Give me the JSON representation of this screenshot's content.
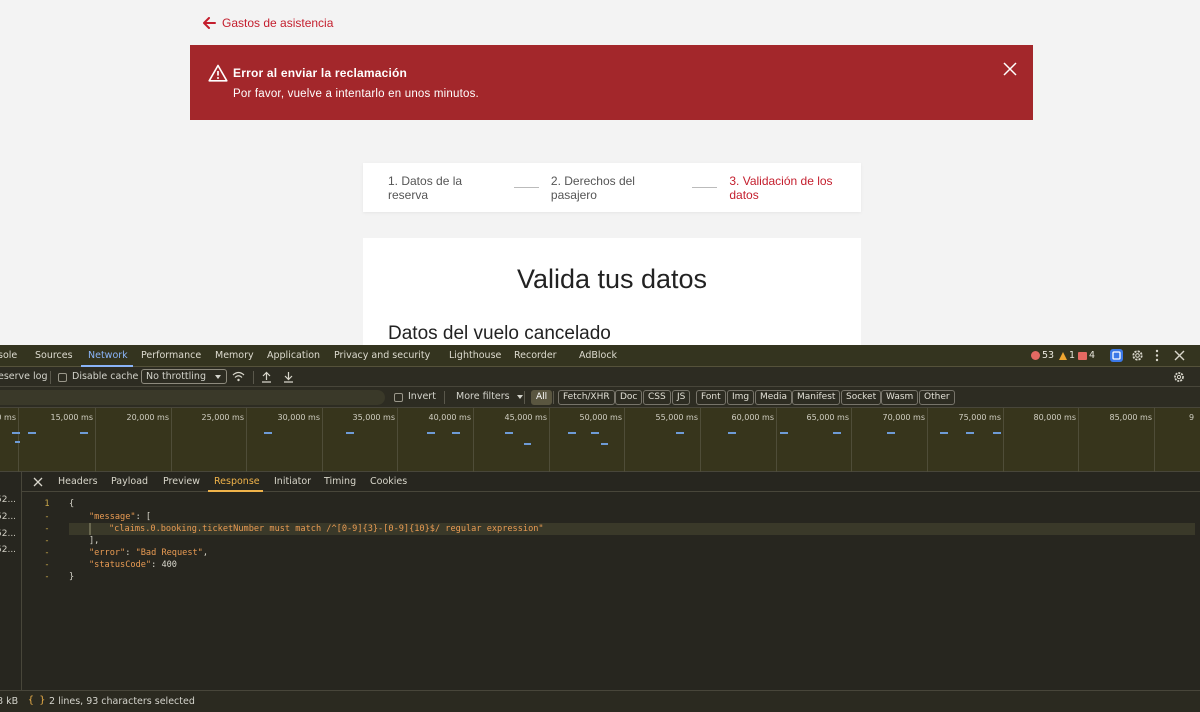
{
  "page": {
    "back_link": "Gastos de asistencia",
    "alert": {
      "title": "Error al enviar la reclamación",
      "message": "Por favor, vuelve a intentarlo en unos minutos.",
      "color": "#a3272b"
    },
    "steps": [
      "1. Datos de la reserva",
      "2. Derechos del pasajero",
      "3. Validación de los datos"
    ],
    "active_step": 3,
    "card_title": "Valida tus datos",
    "section_title": "Datos del vuelo cancelado",
    "accent": "#c41e2d"
  },
  "devtools": {
    "tabs": [
      "sole",
      "Sources",
      "Network",
      "Performance",
      "Memory",
      "Application",
      "Privacy and security",
      "Lighthouse",
      "Recorder",
      "AdBlock"
    ],
    "active_tab": "Network",
    "errors": "53",
    "warnings": "1",
    "issues": "4",
    "toolbar": {
      "preserve_log": "eserve log",
      "disable_cache": "Disable cache",
      "throttling": "No throttling"
    },
    "filter": {
      "invert": "Invert",
      "more_filters": "More filters",
      "types": [
        "All",
        "Fetch/XHR",
        "Doc",
        "CSS",
        "JS",
        "Font",
        "Img",
        "Media",
        "Manifest",
        "Socket",
        "Wasm",
        "Other"
      ]
    },
    "timeline_labels": [
      "0 ms",
      "15,000 ms",
      "20,000 ms",
      "25,000 ms",
      "30,000 ms",
      "35,000 ms",
      "40,000 ms",
      "45,000 ms",
      "50,000 ms",
      "55,000 ms",
      "60,000 ms",
      "65,000 ms",
      "70,000 ms",
      "75,000 ms",
      "80,000 ms",
      "85,000 ms",
      "9"
    ],
    "requests": [
      "52...",
      "52...",
      "52...",
      "52..."
    ],
    "detail_tabs": [
      "Headers",
      "Payload",
      "Preview",
      "Response",
      "Initiator",
      "Timing",
      "Cookies"
    ],
    "active_detail_tab": "Response",
    "response": {
      "line_numbers": [
        "1",
        "-",
        "-",
        "-",
        "-",
        "-",
        "-"
      ],
      "lines": [
        {
          "text": "{"
        },
        {
          "key": "\"message\"",
          "rest": ": ["
        },
        {
          "str": "\"claims.0.booking.ticketNumber must match /^[0-9]{3}-[0-9]{10}$/ regular expression\""
        },
        {
          "text": "],"
        },
        {
          "key": "\"error\"",
          "rest": ": ",
          "str": "\"Bad Request\"",
          "tail": ","
        },
        {
          "key": "\"statusCode\"",
          "rest": ": ",
          "num": "400"
        },
        {
          "text": "}"
        }
      ]
    },
    "status": {
      "size": "8 kB",
      "braces": "{ }",
      "selection": "2 lines, 93 characters selected"
    }
  }
}
